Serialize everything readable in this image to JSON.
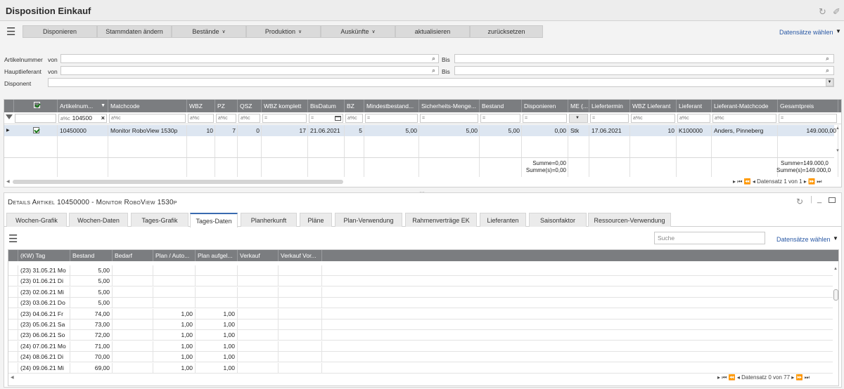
{
  "window": {
    "title": "Disposition Einkauf"
  },
  "toolbar": {
    "buttons": [
      {
        "label": "Disponieren",
        "caret": false
      },
      {
        "label": "Stammdaten ändern",
        "caret": false
      },
      {
        "label": "Bestände",
        "caret": true
      },
      {
        "label": "Produktion",
        "caret": true
      },
      {
        "label": "Auskünfte",
        "caret": true
      },
      {
        "label": "aktualisieren",
        "caret": false
      },
      {
        "label": "zurücksetzen",
        "caret": false
      }
    ],
    "datensaetze_label": "Datensätze wählen"
  },
  "filters": {
    "artikelnummer_label": "Artikelnummer",
    "hauptlieferant_label": "Hauptlieferant",
    "disponent_label": "Disponent",
    "von_label": "von",
    "bis_label": "Bis"
  },
  "grid": {
    "columns": [
      "",
      "Artikelnum...",
      "Matchcode",
      "WBZ",
      "PZ",
      "QSZ",
      "WBZ komplett",
      "BisDatum",
      "BZ",
      "Mindestbestand...",
      "Sicherheits-Menge...",
      "Bestand",
      "Disponieren",
      "ME (...",
      "Liefertermin",
      "WBZ Lieferant",
      "Lieferant",
      "Lieferant-Matchcode",
      "Gesamtpreis"
    ],
    "filter_artikel_value": "104500",
    "filter_placeholder_abc": "a%c",
    "filter_placeholder_eq": "=",
    "row": {
      "artikelnummer": "10450000",
      "matchcode": "Monitor RoboView 1530p",
      "wbz": "10",
      "pz": "7",
      "qsz": "0",
      "wbz_komplett": "17",
      "bisdatum": "21.06.2021",
      "bz": "5",
      "mindestbestand": "5,00",
      "sicherheitsmenge": "5,00",
      "bestand": "5,00",
      "disponieren": "0,00",
      "me": "Stk",
      "liefertermin": "17.06.2021",
      "wbz_lieferant": "10",
      "lieferant": "K100000",
      "lieferant_matchcode": "Anders, Pinneberg",
      "gesamtpreis": "149.000,00"
    },
    "summary": {
      "disp_sum": "Summe=0,00",
      "disp_sums": "Summe(s)=0,00",
      "preis_sum": "Summe=149.000,0",
      "preis_sums": "Summe(s)=149.000,0"
    },
    "pager": "Datensatz 1 von 1"
  },
  "details": {
    "title": "Details Artikel 10450000 - Monitor RoboView 1530p",
    "tabs": [
      "Wochen-Grafik",
      "Wochen-Daten",
      "Tages-Grafik",
      "Tages-Daten",
      "Planherkunft",
      "Pläne",
      "Plan-Verwendung",
      "Rahmenverträge EK",
      "Lieferanten",
      "Saisonfaktor",
      "Ressourcen-Verwendung"
    ],
    "active_tab": 3,
    "search_placeholder": "Suche",
    "datensaetze_label": "Datensätze wählen",
    "columns": [
      "(KW) Tag",
      "Bestand",
      "Bedarf",
      "Plan / Auto...",
      "Plan aufgel...",
      "Verkauf",
      "Verkauf Vor..."
    ],
    "rows": [
      [
        "(23) 31.05.21 Mo",
        "5,00",
        "",
        "",
        ""
      ],
      [
        "(23) 01.06.21 Di",
        "5,00",
        "",
        "",
        ""
      ],
      [
        "(23) 02.06.21 Mi",
        "5,00",
        "",
        "",
        ""
      ],
      [
        "(23) 03.06.21 Do",
        "5,00",
        "",
        "",
        ""
      ],
      [
        "(23) 04.06.21 Fr",
        "74,00",
        "",
        "1,00",
        "1,00"
      ],
      [
        "(23) 05.06.21 Sa",
        "73,00",
        "",
        "1,00",
        "1,00"
      ],
      [
        "(23) 06.06.21 So",
        "72,00",
        "",
        "1,00",
        "1,00"
      ],
      [
        "(24) 07.06.21 Mo",
        "71,00",
        "",
        "1,00",
        "1,00"
      ],
      [
        "(24) 08.06.21 Di",
        "70,00",
        "",
        "1,00",
        "1,00"
      ],
      [
        "(24) 09.06.21 Mi",
        "69,00",
        "",
        "1,00",
        "1,00"
      ]
    ],
    "pager": "Datensatz 0 von 77"
  }
}
